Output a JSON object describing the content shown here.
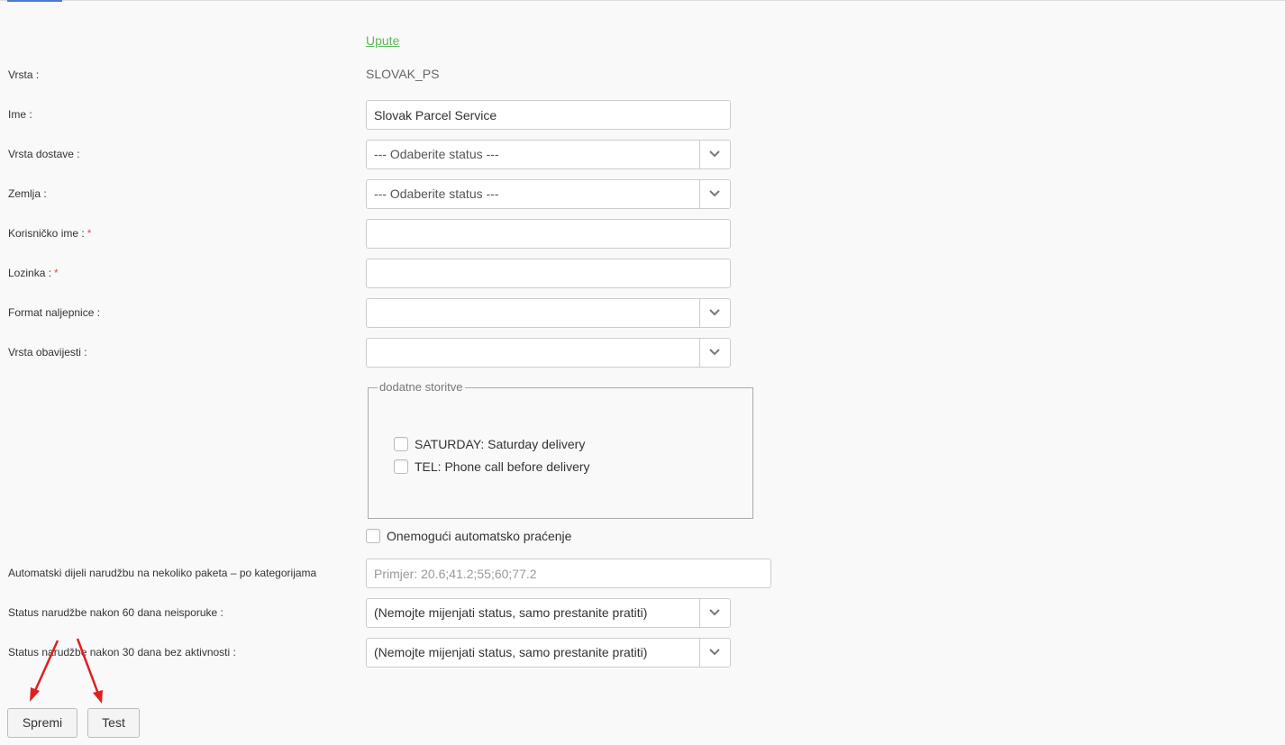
{
  "links": {
    "help": "Upute"
  },
  "form": {
    "type": {
      "label": "Vrsta :",
      "value": "SLOVAK_PS"
    },
    "name": {
      "label": "Ime :",
      "value": "Slovak Parcel Service"
    },
    "delivery_type": {
      "label": "Vrsta dostave :",
      "selected": "--- Odaberite status ---"
    },
    "country": {
      "label": "Zemlja :",
      "selected": "--- Odaberite status ---"
    },
    "username": {
      "label": "Korisničko ime :",
      "required_mark": "*",
      "value": ""
    },
    "password": {
      "label": "Lozinka :",
      "required_mark": "*",
      "value": ""
    },
    "label_format": {
      "label": "Format naljepnice :",
      "selected": ""
    },
    "notification_type": {
      "label": "Vrsta obavijesti :",
      "selected": ""
    },
    "additional_services": {
      "legend": "dodatne storitve",
      "options": [
        {
          "label": "SATURDAY: Saturday delivery",
          "checked": false
        },
        {
          "label": "TEL: Phone call before delivery",
          "checked": false
        }
      ]
    },
    "disable_tracking": {
      "label": "Onemogući automatsko praćenje",
      "checked": false
    },
    "auto_split": {
      "label": "Automatski dijeli narudžbu na nekoliko paketa – po kategorijama",
      "placeholder": "Primjer: 20.6;41.2;55;60;77.2",
      "value": ""
    },
    "status_60": {
      "label": "Status narudžbe nakon 60 dana neisporuke :",
      "selected": "(Nemojte mijenjati status, samo prestanite pratiti)"
    },
    "status_30": {
      "label": "Status narudžbe nakon 30 dana bez aktivnosti :",
      "selected": "(Nemojte mijenjati status, samo prestanite pratiti)"
    }
  },
  "buttons": {
    "save": "Spremi",
    "test": "Test"
  },
  "colors": {
    "link": "#5cb85c",
    "required": "#d9534f",
    "annotation_arrow": "#e02020",
    "active_tab": "#4a7bd0"
  },
  "icons": {
    "select_toggle": "chevron-down-icon"
  }
}
